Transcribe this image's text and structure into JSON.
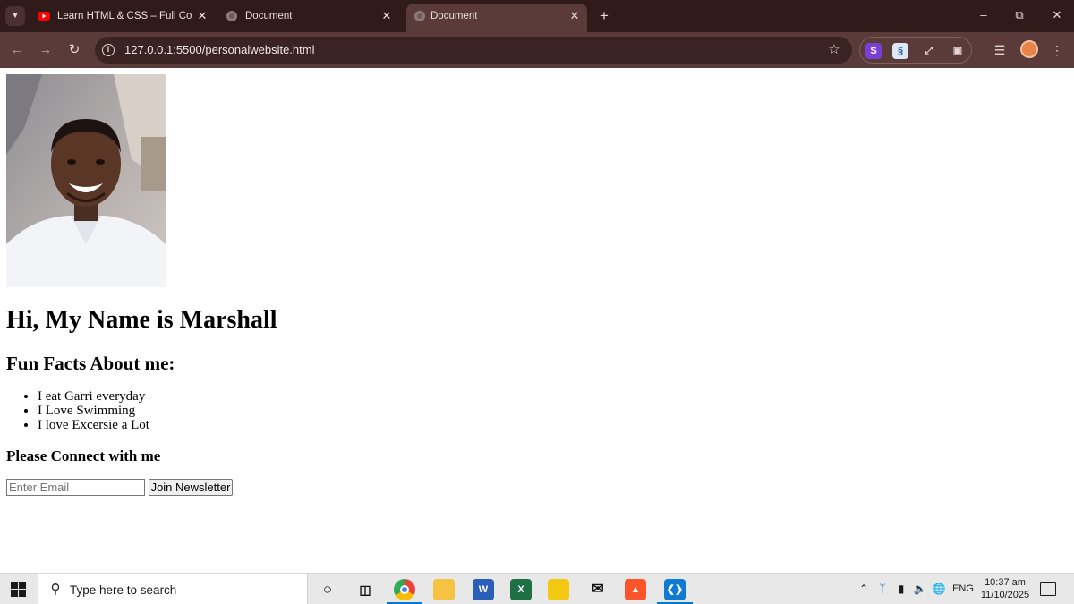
{
  "browser": {
    "tabs": [
      {
        "title": "Learn HTML & CSS – Full Cours",
        "favicon": "youtube-icon",
        "active": false
      },
      {
        "title": "Document",
        "favicon": "globe-icon",
        "active": false
      },
      {
        "title": "Document",
        "favicon": "globe-icon",
        "active": true
      }
    ],
    "url": "127.0.0.1:5500/personalwebsite.html",
    "colors": {
      "frame": "#311b1a",
      "toolbar": "#5a3b39",
      "omnibox": "#3a2322"
    }
  },
  "page": {
    "title": "Hi, My Name is Marshall",
    "facts_heading": "Fun Facts About me:",
    "facts": [
      "I eat Garri everyday",
      "I Love Swimming",
      "I love Excersie a Lot"
    ],
    "connect_heading": "Please Connect with me",
    "email_placeholder": "Enter Email",
    "join_button": "Join Newsletter"
  },
  "taskbar": {
    "search_placeholder": "Type here to search",
    "pinned": [
      "cortana-icon",
      "task-view-icon",
      "chrome-icon",
      "file-explorer-icon",
      "word-icon",
      "excel-icon",
      "power-bi-icon",
      "mail-icon",
      "brave-icon",
      "vscode-icon"
    ],
    "language": "ENG",
    "time": "10:37 am",
    "date": "11/10/2025"
  }
}
